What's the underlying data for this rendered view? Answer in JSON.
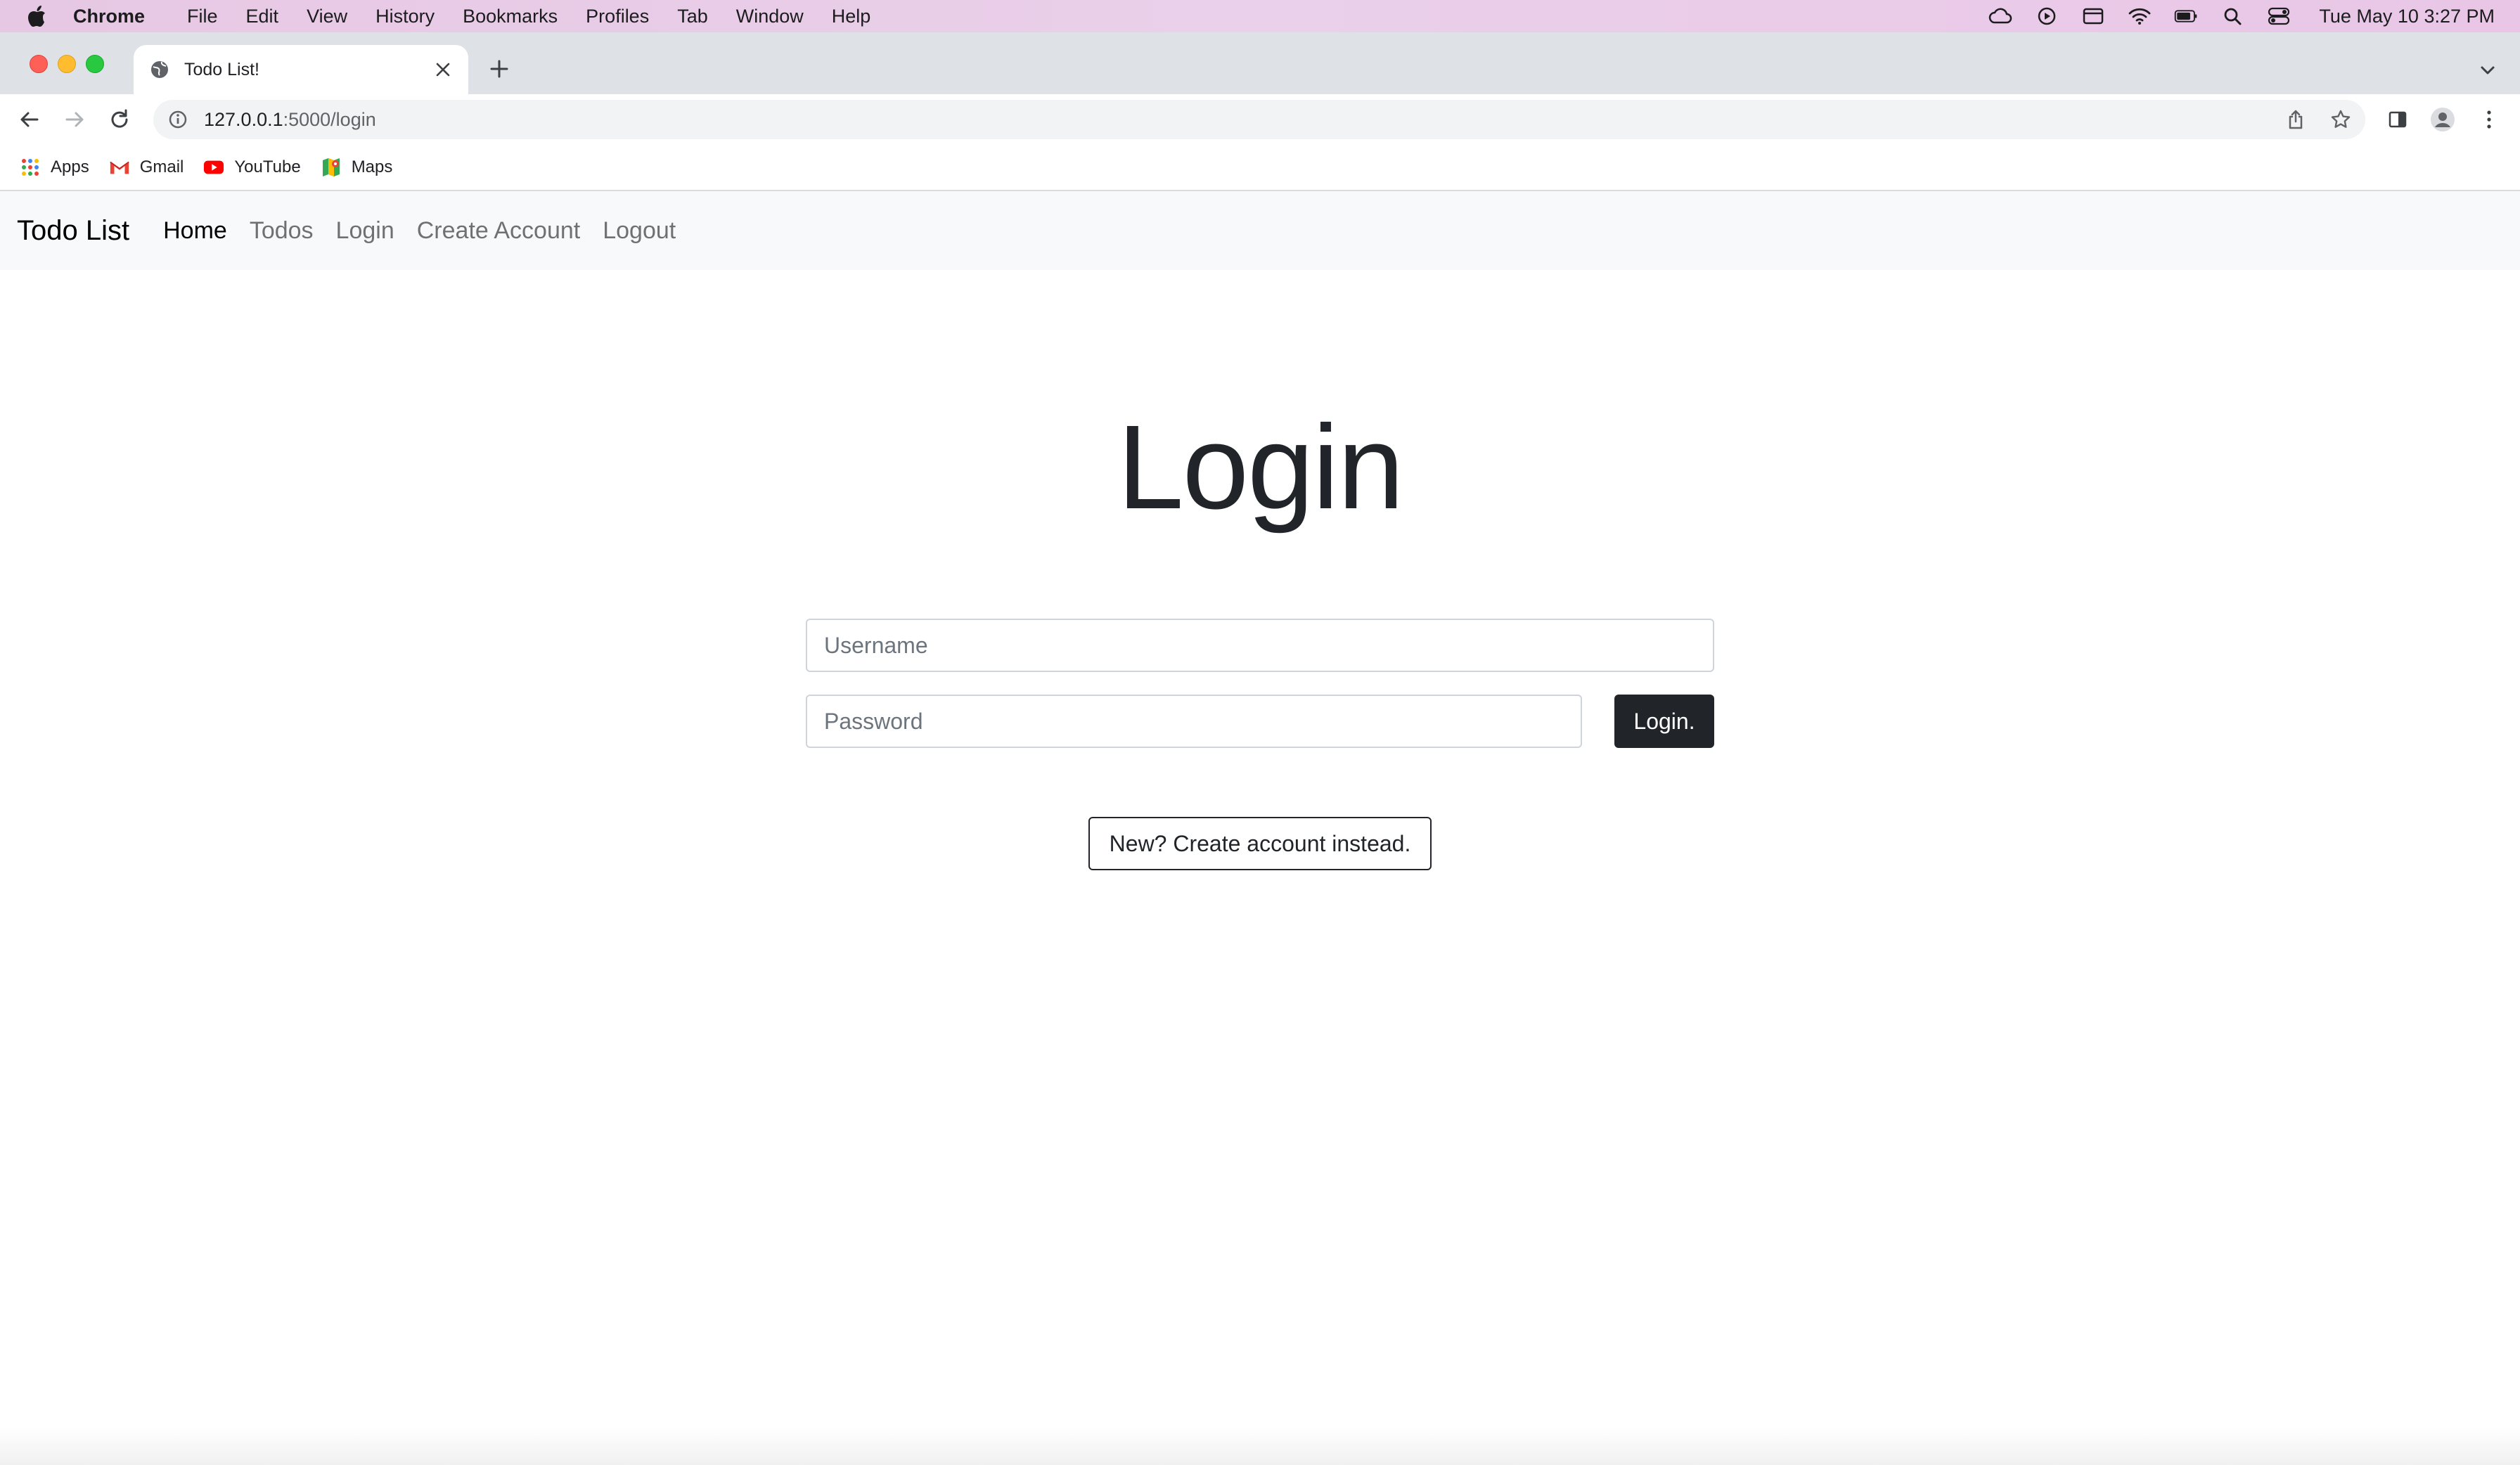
{
  "menubar": {
    "app": "Chrome",
    "items": [
      "File",
      "Edit",
      "View",
      "History",
      "Bookmarks",
      "Profiles",
      "Tab",
      "Window",
      "Help"
    ],
    "clock": "Tue May 10  3:27 PM"
  },
  "browser": {
    "tab_title": "Todo List!",
    "url_host": "127.0.0.1",
    "url_path": ":5000/login",
    "bookmarks": [
      "Apps",
      "Gmail",
      "YouTube",
      "Maps"
    ]
  },
  "site": {
    "brand": "Todo List",
    "nav": [
      "Home",
      "Todos",
      "Login",
      "Create Account",
      "Logout"
    ],
    "active_nav": "Home"
  },
  "login": {
    "title": "Login",
    "username_placeholder": "Username",
    "username_value": "",
    "password_placeholder": "Password",
    "password_value": "",
    "submit_label": "Login.",
    "create_label": "New? Create account instead."
  },
  "colors": {
    "primary_dark": "#212529",
    "navbar_bg": "#f8f9fa",
    "input_border": "#ced4da"
  },
  "icons": {
    "apple": "apple-icon",
    "favicon": "globe-icon",
    "tab_close": "close-icon",
    "new_tab": "plus-icon",
    "back": "arrow-left-icon",
    "forward": "arrow-right-icon",
    "reload": "reload-icon",
    "site_info": "info-icon",
    "share": "share-icon",
    "bookmark": "star-icon",
    "side_panel": "side-panel-icon",
    "profile": "profile-icon",
    "menu": "kebab-menu-icon"
  }
}
